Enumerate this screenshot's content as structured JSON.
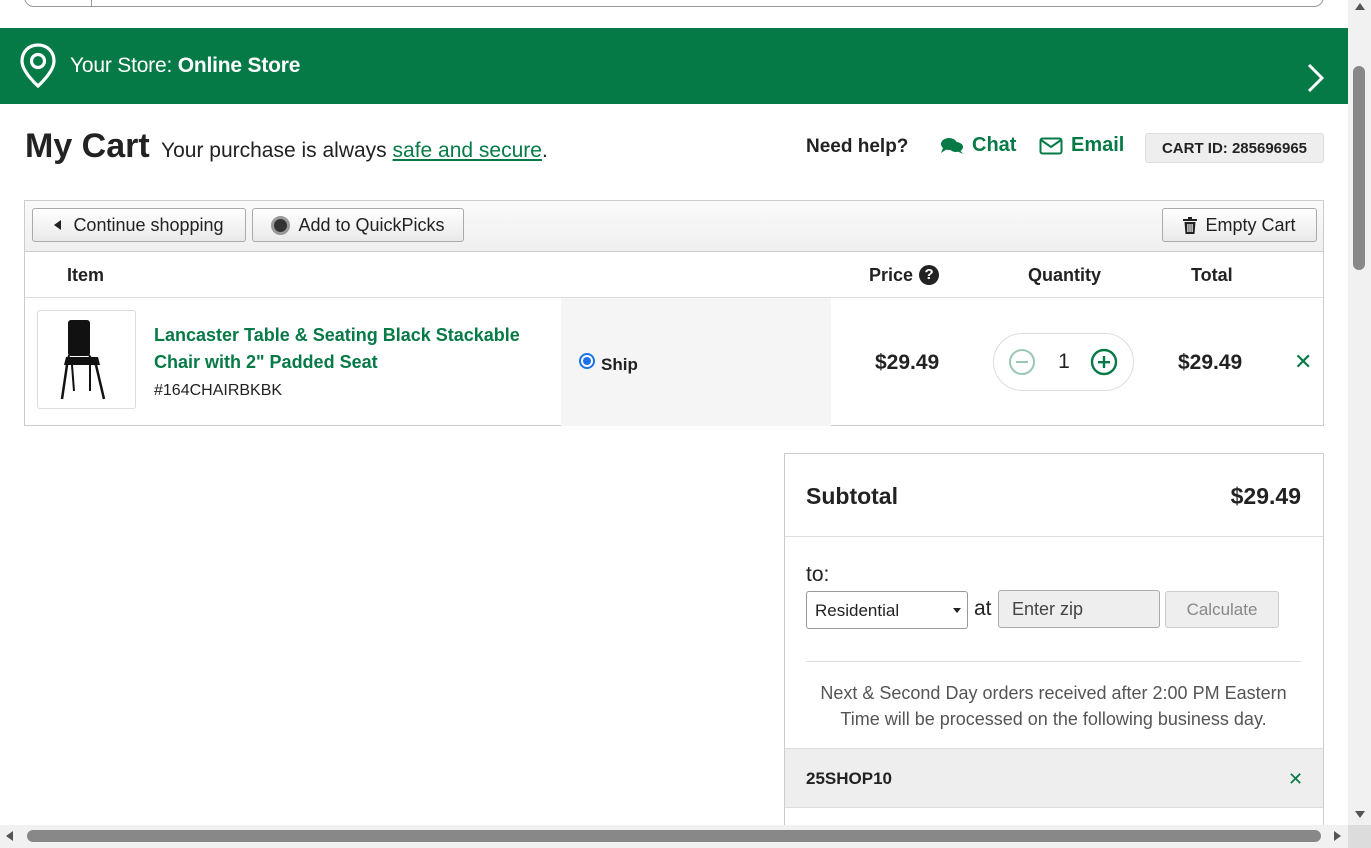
{
  "store_bar": {
    "prefix": "Your Store: ",
    "store_name": "Online Store"
  },
  "header": {
    "title": "My Cart",
    "subtitle_prefix": "Your purchase is always ",
    "subtitle_link": "safe and secure",
    "subtitle_suffix": ".",
    "need_help": "Need help?",
    "chat": "Chat",
    "email": "Email",
    "cart_id": "CART ID: 285696965"
  },
  "toolbar": {
    "continue_shopping": "Continue shopping",
    "add_quickpicks": "Add to QuickPicks",
    "empty_cart": "Empty Cart"
  },
  "table": {
    "columns": {
      "item": "Item",
      "price": "Price",
      "quantity": "Quantity",
      "total": "Total"
    },
    "items": [
      {
        "name": "Lancaster Table & Seating Black Stackable Chair with 2\" Padded Seat",
        "sku": "#164CHAIRBKBK",
        "fulfillment": "Ship",
        "price": "$29.49",
        "quantity": "1",
        "total": "$29.49"
      }
    ]
  },
  "summary": {
    "subtotal_label": "Subtotal",
    "subtotal_value": "$29.49",
    "to_label": "to:",
    "address_type": "Residential",
    "at_label": "at",
    "zip_placeholder": "Enter zip",
    "calculate": "Calculate",
    "notice": "Next & Second Day orders received after 2:00 PM Eastern Time will be processed on the following business day.",
    "promo_code": "25SHOP10"
  },
  "colors": {
    "brand_green": "#067a46"
  }
}
